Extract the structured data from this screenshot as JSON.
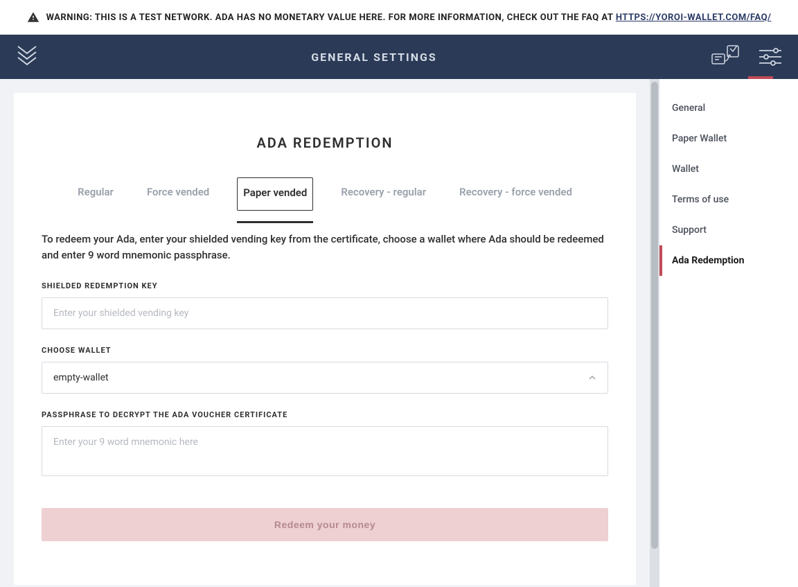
{
  "banner": {
    "text_prefix": "WARNING: THIS IS A TEST NETWORK. ADA HAS NO MONETARY VALUE HERE. FOR MORE INFORMATION, CHECK OUT THE FAQ AT ",
    "link_text": "HTTPS://YOROI-WALLET.COM/FAQ/"
  },
  "header": {
    "title": "GENERAL SETTINGS"
  },
  "sidebar": {
    "items": [
      {
        "label": "General"
      },
      {
        "label": "Paper Wallet"
      },
      {
        "label": "Wallet"
      },
      {
        "label": "Terms of use"
      },
      {
        "label": "Support"
      },
      {
        "label": "Ada Redemption"
      }
    ],
    "active_index": 5
  },
  "page": {
    "title": "ADA REDEMPTION",
    "tabs": [
      {
        "label": "Regular"
      },
      {
        "label": "Force vended"
      },
      {
        "label": "Paper vended"
      },
      {
        "label": "Recovery - regular"
      },
      {
        "label": "Recovery - force vended"
      }
    ],
    "active_tab_index": 2,
    "intro": "To redeem your Ada, enter your shielded vending key from the certificate, choose a wallet where Ada should be redeemed and enter 9 word mnemonic passphrase.",
    "fields": {
      "redemption_key": {
        "label": "SHIELDED REDEMPTION KEY",
        "placeholder": "Enter your shielded vending key",
        "value": ""
      },
      "wallet": {
        "label": "CHOOSE WALLET",
        "selected": "empty-wallet"
      },
      "passphrase": {
        "label": "PASSPHRASE TO DECRYPT THE ADA VOUCHER CERTIFICATE",
        "placeholder": "Enter your 9 word mnemonic here",
        "value": ""
      }
    },
    "submit_label": "Redeem your money"
  },
  "colors": {
    "accent": "#c14b57",
    "header_bg": "#2b3a56"
  }
}
